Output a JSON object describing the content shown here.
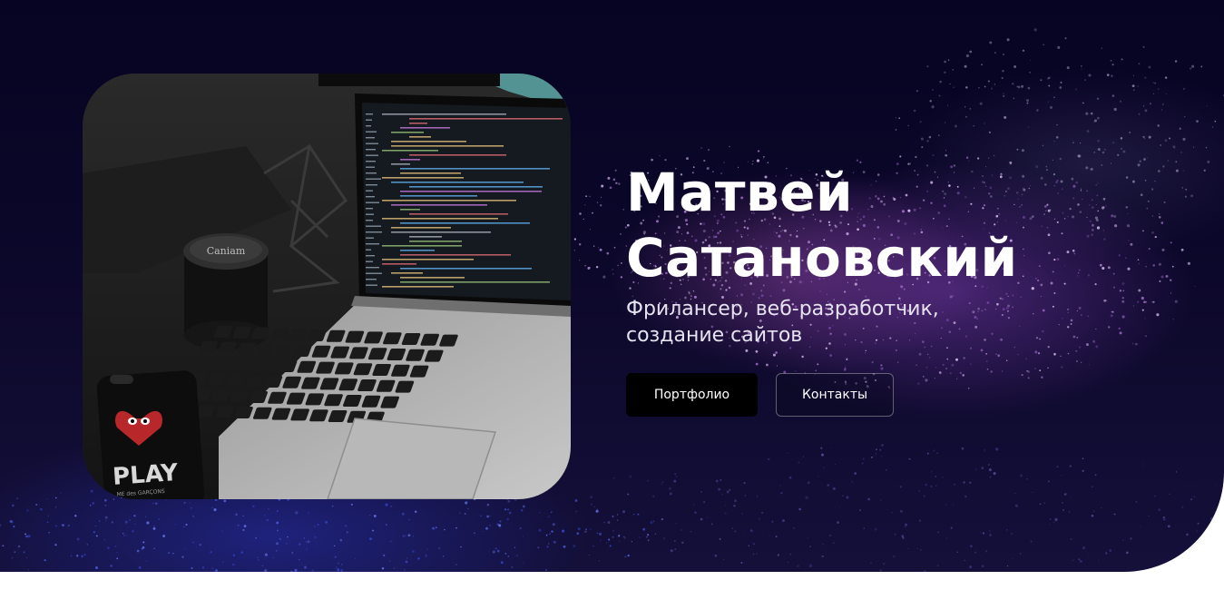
{
  "hero": {
    "name_line1": "Матвей",
    "name_line2": "Сатановский",
    "subtitle": "Фрилансер, веб-разработчик, создание сайтов",
    "photo_alt": "Ноутбук с кодом на рабочем столе",
    "buttons": {
      "portfolio": "Портфолио",
      "contacts": "Контакты"
    }
  },
  "photo": {
    "lens_cap_text": "Caniam",
    "phone_case_text": "PLAY",
    "phone_case_subtext": "ME des GARÇONS"
  },
  "colors": {
    "background_dark": "#070322",
    "accent_purple": "#7b3ca8",
    "accent_blue": "#2832b4",
    "button_primary": "#000000",
    "text": "#ffffff"
  }
}
